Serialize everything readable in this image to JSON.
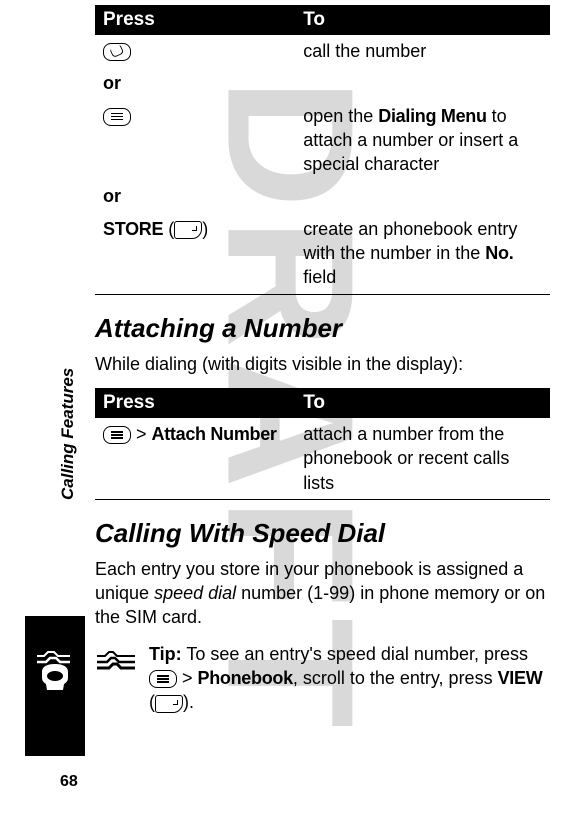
{
  "watermark": "DRAFT",
  "sidebar_label": "Calling Features",
  "page_number": "68",
  "table1": {
    "header_press": "Press",
    "header_to": "To",
    "row1_to": "call the number",
    "or": "or",
    "row2_to_pre": "open the ",
    "row2_to_bold": "Dialing Menu",
    "row2_to_post": " to attach a number or insert a special character",
    "row3_press": "STORE",
    "row3_to_pre": "create an phonebook entry with the number in the ",
    "row3_to_bold": "No.",
    "row3_to_post": " field"
  },
  "section1_title": "Attaching a Number",
  "section1_body": "While dialing (with digits visible in the display):",
  "table2": {
    "header_press": "Press",
    "header_to": "To",
    "row1_press_sep": " > ",
    "row1_press_bold": "Attach Number",
    "row1_to": "attach a number from the phonebook or recent calls lists"
  },
  "section2_title": "Calling With Speed Dial",
  "section2_body_pre": "Each entry you store in your phonebook is assigned a unique ",
  "section2_body_ital": "speed dial",
  "section2_body_post": " number (1-99) in phone memory or on the SIM card.",
  "tip_label": "Tip:",
  "tip_text_pre": " To see an entry's speed dial number, press ",
  "tip_text_sep": " > ",
  "tip_text_bold1": "Phonebook",
  "tip_text_mid": ", scroll to the entry, press ",
  "tip_text_bold2": "VIEW",
  "tip_text_paren_open": " (",
  "tip_text_paren_close": ")."
}
